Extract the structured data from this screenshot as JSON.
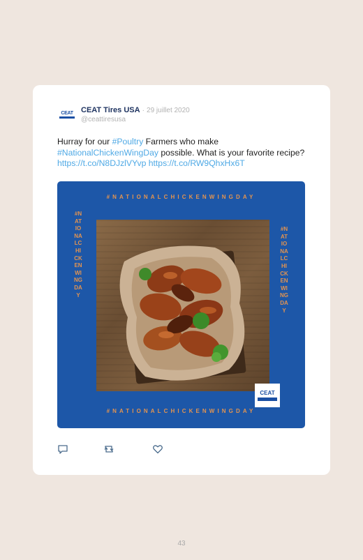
{
  "tweet": {
    "avatar_text": "CEAT",
    "author_name": "CEAT Tires USA",
    "separator": "·",
    "date": "29 juillet 2020",
    "handle": "@ceattiresusa",
    "text": {
      "part1": "Hurray for our ",
      "hashtag1": "#Poultry",
      "part2": " Farmers who make ",
      "hashtag2": "#NationalChickenWingDay",
      "part3": " possible. What is your favorite recipe? ",
      "link1": "https://t.co/N8DJzlVYvp",
      "link2": "https://t.co/RW9QhxHx6T"
    },
    "media": {
      "hashtag": "#NATIONALCHICKENWINGDAY",
      "badge_text": "CEAT",
      "colors": {
        "background": "#1d57a8",
        "hashtag": "#e39450"
      }
    },
    "actions": {
      "reply_icon": "reply-icon",
      "retweet_icon": "retweet-icon",
      "like_icon": "heart-icon"
    }
  },
  "page": {
    "number": "43"
  },
  "colors": {
    "page_bg": "#efe6df",
    "link": "#4fa9e5",
    "author": "#1e3360"
  }
}
